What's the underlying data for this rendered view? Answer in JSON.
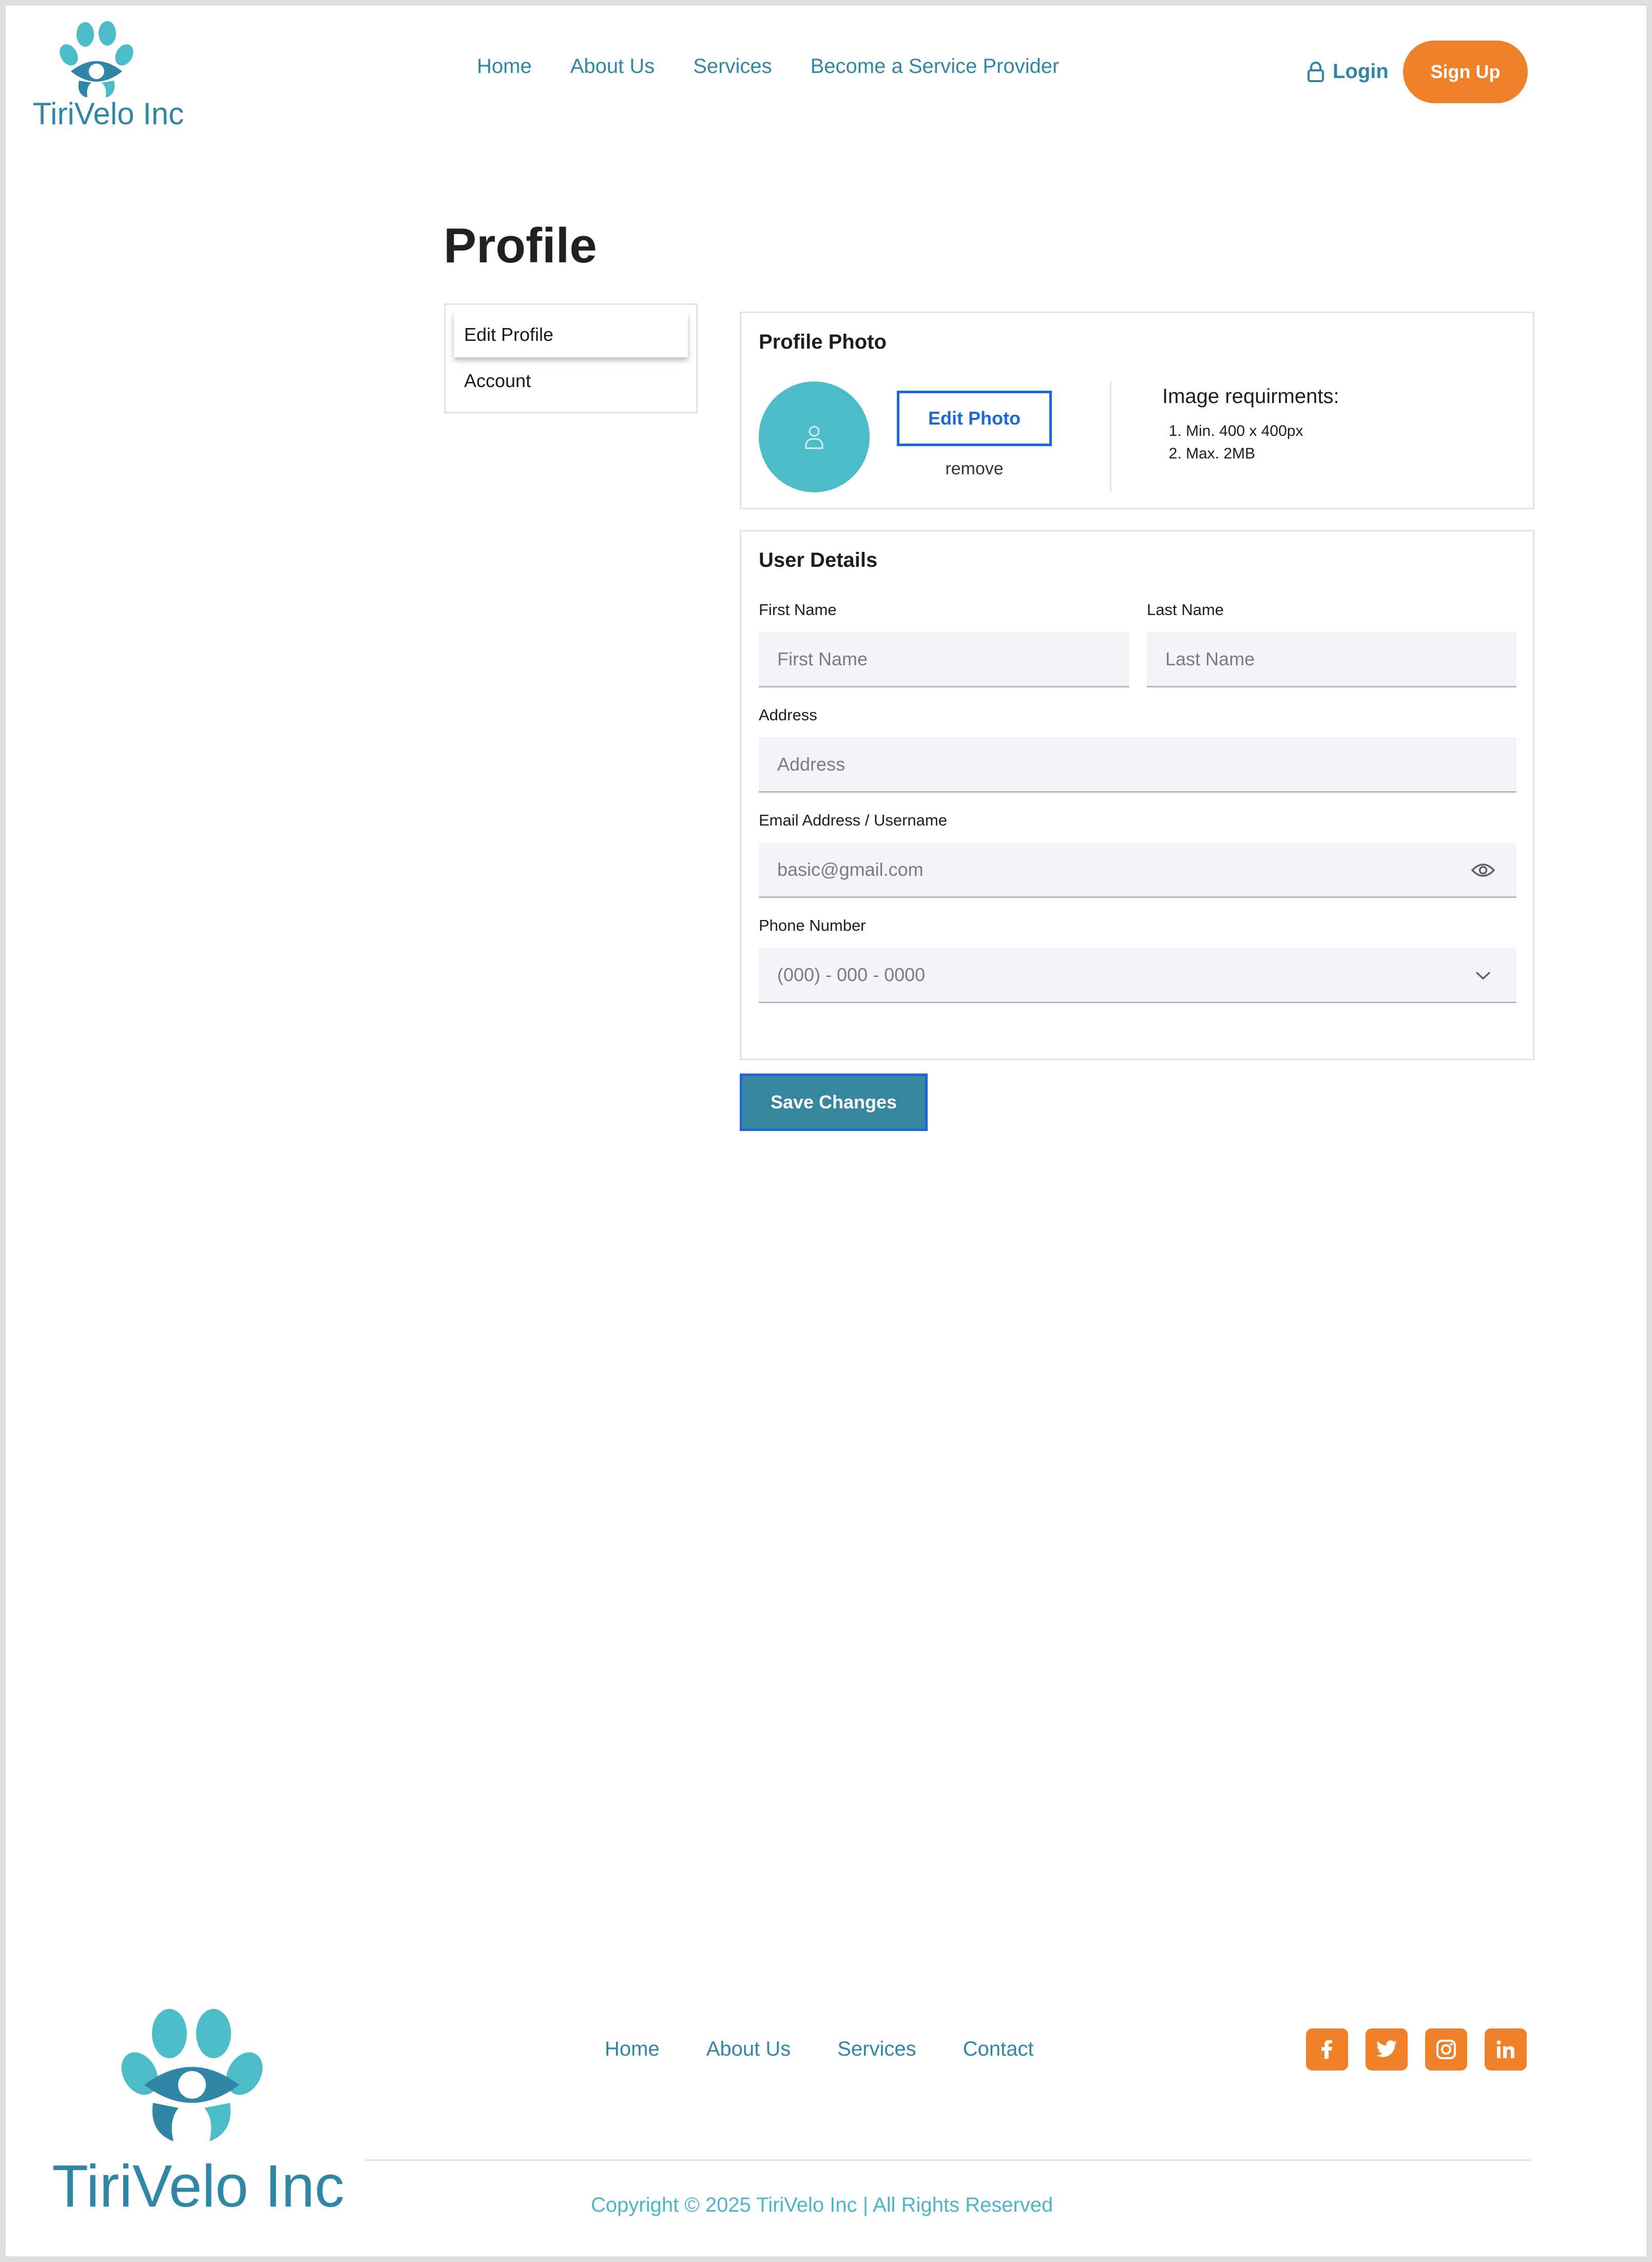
{
  "brand": {
    "name": "TiriVelo Inc",
    "primary_color": "#2f86a6",
    "accent_color": "#ef8128",
    "light_teal": "#4bbcc8"
  },
  "header": {
    "nav": [
      "Home",
      "About Us",
      "Services",
      "Become a Service Provider"
    ],
    "login_label": "Login",
    "signup_label": "Sign Up"
  },
  "page": {
    "title": "Profile"
  },
  "side_menu": {
    "items": [
      "Edit Profile",
      "Account"
    ],
    "active": "Edit Profile"
  },
  "profile_photo": {
    "title": "Profile Photo",
    "edit_label": "Edit Photo",
    "remove_label": "remove",
    "requirements_title": "Image requirments:",
    "requirements": [
      "Min.  400 x 400px",
      "Max. 2MB"
    ]
  },
  "user_details": {
    "title": "User Details",
    "first_name": {
      "label": "First Name",
      "placeholder": "First Name"
    },
    "last_name": {
      "label": "Last Name",
      "placeholder": "Last Name"
    },
    "address": {
      "label": "Address",
      "placeholder": "Address"
    },
    "email": {
      "label": "Email Address / Username",
      "value": "basic@gmail.com"
    },
    "phone": {
      "label": "Phone Number",
      "placeholder": "(000) - 000 - 0000"
    }
  },
  "save_label": "Save Changes",
  "footer": {
    "nav": [
      "Home",
      "About Us",
      "Services",
      "Contact"
    ],
    "social": [
      "facebook-icon",
      "twitter-icon",
      "instagram-icon",
      "linkedin-icon"
    ],
    "copyright": "Copyright © 2025 TiriVelo Inc | All Rights Reserved"
  }
}
